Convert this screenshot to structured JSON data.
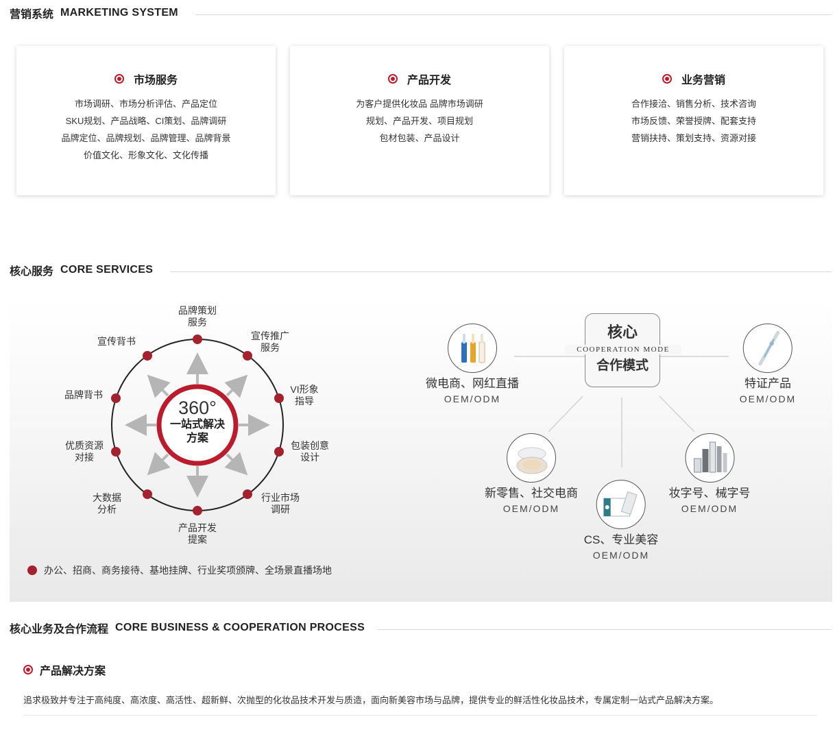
{
  "sections": {
    "marketing": {
      "zh": "营销系统",
      "en": "MARKETING SYSTEM"
    },
    "core_services": {
      "zh": "核心服务",
      "en": "CORE SERVICES"
    },
    "core_business": {
      "zh": "核心业务及合作流程",
      "en": "CORE BUSINESS & COOPERATION PROCESS"
    }
  },
  "cards": [
    {
      "title": "市场服务",
      "lines": [
        "市场调研、市场分析评估、产品定位",
        "SKU规划、产品战略、CI策划、品牌调研",
        "品牌定位、品牌规划、品牌管理、品牌背景",
        "价值文化、形象文化、文化传播"
      ]
    },
    {
      "title": "产品开发",
      "lines": [
        "为客户提供化妆品 品牌市场调研",
        "规划、产品开发、项目规划",
        "包材包装、产品设计"
      ]
    },
    {
      "title": "业务营销",
      "lines": [
        "合作接洽、销售分析、技术咨询",
        "市场反馈、荣誉授牌、配套支持",
        "营销扶持、策划支持、资源对接"
      ]
    }
  ],
  "wheel": {
    "center": {
      "line1": "360°",
      "line2": "一站式解决",
      "line3": "方案"
    },
    "labels": [
      {
        "l1": "品牌策划",
        "l2": "服务"
      },
      {
        "l1": "宣传推广",
        "l2": "服务"
      },
      {
        "l1": "VI形象",
        "l2": "指导"
      },
      {
        "l1": "包装创意",
        "l2": "设计"
      },
      {
        "l1": "行业市场",
        "l2": "调研"
      },
      {
        "l1": "产品开发",
        "l2": "提案"
      },
      {
        "l1": "大数据",
        "l2": "分析"
      },
      {
        "l1": "优质资源",
        "l2": "对接"
      },
      {
        "l1": "品牌背书",
        "l2": ""
      },
      {
        "l1": "宣传背书",
        "l2": ""
      }
    ],
    "legend": "办公、招商、商务接待、基地挂牌、行业奖项颁牌、全场景直播场地"
  },
  "cooperation": {
    "center": {
      "t1": "核心",
      "t2": "COOPERATION MODE",
      "t3": "合作模式"
    },
    "items": [
      {
        "name": "微电商、网红直播",
        "sub": "OEM/ODM",
        "icon": "ampoule-icon"
      },
      {
        "name": "特证产品",
        "sub": "OEM/ODM",
        "icon": "pen-icon"
      },
      {
        "name": "新零售、社交电商",
        "sub": "OEM/ODM",
        "icon": "cushion-icon"
      },
      {
        "name": "CS、专业美容",
        "sub": "OEM/ODM",
        "icon": "mask-box-icon"
      },
      {
        "name": "妆字号、械字号",
        "sub": "OEM/ODM",
        "icon": "bottles-icon"
      }
    ]
  },
  "business": {
    "title": "产品解决方案",
    "text": "追求极致并专注于高纯度、高浓度、高活性、超新鲜、次抛型的化妆品技术开发与质造，面向新美容市场与品牌，提供专业的鲜活性化妆品技术，专属定制一站式产品解决方案。"
  },
  "colors": {
    "accent": "#b81c2d",
    "dot": "#a3222e"
  }
}
